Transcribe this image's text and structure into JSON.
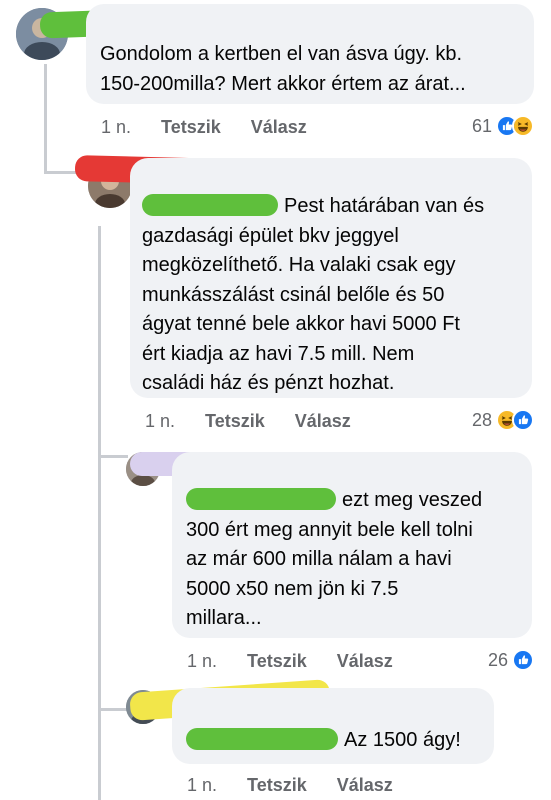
{
  "comments": [
    {
      "text": "Gondolom a kertben el van ásva úgy. kb.\n150-200milla? Mert akkor értem az árat...",
      "time": "1 n.",
      "like_label": "Tetszik",
      "reply_label": "Válasz",
      "reaction_count": "61",
      "reactions": [
        "like",
        "haha"
      ]
    },
    {
      "text": "Pest határában van és\ngazdasági épület bkv jeggyel\nmegközelíthető. Ha valaki csak egy\n munkásszálást csinál belőle és 50\nágyat tenné bele akkor havi 5000 Ft\nért kiadja az havi 7.5 mill. Nem\ncsaládi ház és pénzt hozhat.",
      "time": "1 n.",
      "like_label": "Tetszik",
      "reply_label": "Válasz",
      "reaction_count": "28",
      "reactions": [
        "haha",
        "like"
      ]
    },
    {
      "text": "ezt meg veszed\n300 ért meg annyit bele kell tolni\naz már 600 milla  nálam a havi\n5000 x50 nem jön ki 7.5\nmillara...",
      "time": "1 n.",
      "like_label": "Tetszik",
      "reply_label": "Válasz",
      "reaction_count": "26",
      "reactions": [
        "like"
      ]
    },
    {
      "text": "Az 1500 ágy!",
      "time": "1 n.",
      "like_label": "Tetszik",
      "reply_label": "Válasz"
    }
  ],
  "colors": {
    "bubble": "#f0f2f5",
    "meta": "#65676b",
    "like_blue": "#1877f2",
    "haha_yellow": "#f7b928",
    "mark_green": "#5fbf3c",
    "mark_red": "#e53935",
    "mark_lavender": "#d9d0ee",
    "mark_yellow": "#f2e64a"
  }
}
